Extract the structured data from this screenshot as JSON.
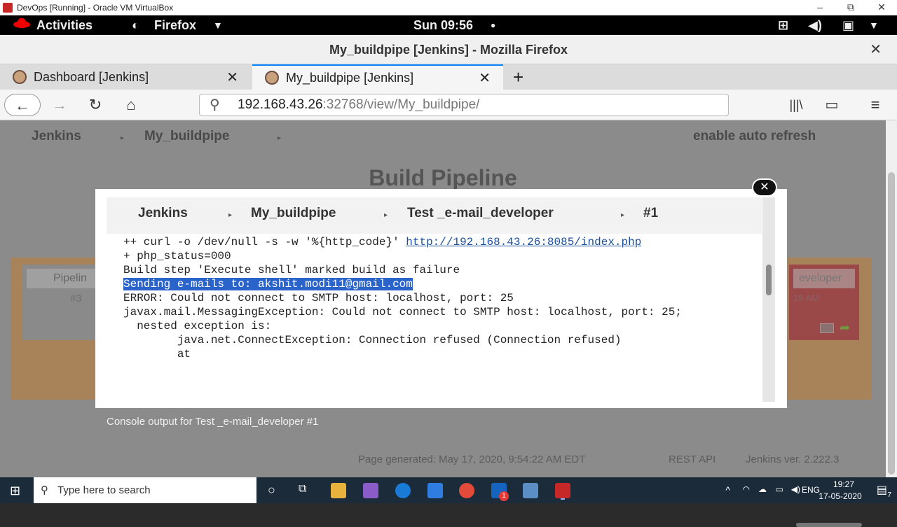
{
  "vbox": {
    "title": "DevOps [Running] - Oracle VM VirtualBox",
    "min": "–",
    "restore": "⧉",
    "close": "✕"
  },
  "gnome": {
    "activities": "Activities",
    "app": "Firefox",
    "clock": "Sun 09:56"
  },
  "firefox": {
    "window_title": "My_buildpipe [Jenkins] - Mozilla Firefox",
    "close": "✕",
    "tabs": [
      {
        "label": "Dashboard [Jenkins]",
        "close": "✕"
      },
      {
        "label": "My_buildpipe [Jenkins]",
        "close": "✕"
      }
    ],
    "new_tab": "+",
    "url_host": "192.168.43.26",
    "url_rest": ":32768/view/My_buildpipe/"
  },
  "page": {
    "crumbs": [
      "Jenkins",
      "My_buildpipe"
    ],
    "auto_refresh": "enable auto refresh",
    "title": "Build Pipeline",
    "left_card_title": "Pipelin",
    "left_card_sub": "#3",
    "right_card_title": "eveloper",
    "right_card_time": "18 AM",
    "console_caption": "Console output for Test _e-mail_developer #1",
    "footer": {
      "generated": "Page generated: May 17, 2020, 9:54:22 AM EDT",
      "rest": "REST API",
      "version": "Jenkins ver. 2.222.3"
    }
  },
  "modal": {
    "crumbs": [
      "Jenkins",
      "My_buildpipe",
      "Test _e-mail_developer",
      "#1"
    ],
    "close": "✕",
    "console": {
      "line1_pre": "++ curl -o /dev/null -s -w '%{http_code}' ",
      "line1_link": "http://192.168.43.26:8085/index.php",
      "line2": "+ php_status=000",
      "line3": "Build step 'Execute shell' marked build as failure",
      "line4": "Sending e-mails to: akshit.modi11@gmail.com",
      "line5": "ERROR: Could not connect to SMTP host: localhost, port: 25",
      "line6": "javax.mail.MessagingException: Could not connect to SMTP host: localhost, port: 25;",
      "line7": "  nested exception is:",
      "line8": "\tjava.net.ConnectException: Connection refused (Connection refused)",
      "line9": "\tat"
    }
  },
  "taskbar": {
    "search_placeholder": "Type here to search",
    "lang": "ENG",
    "time": "19:27",
    "date": "17-05-2020",
    "notif_count": "7",
    "mail_badge": "1"
  },
  "colors": {
    "highlight": "#2a63c9",
    "page_overlay": "#8b8b8b",
    "pipeline_bg": "#a8835a",
    "failed_card": "#9a4848"
  }
}
